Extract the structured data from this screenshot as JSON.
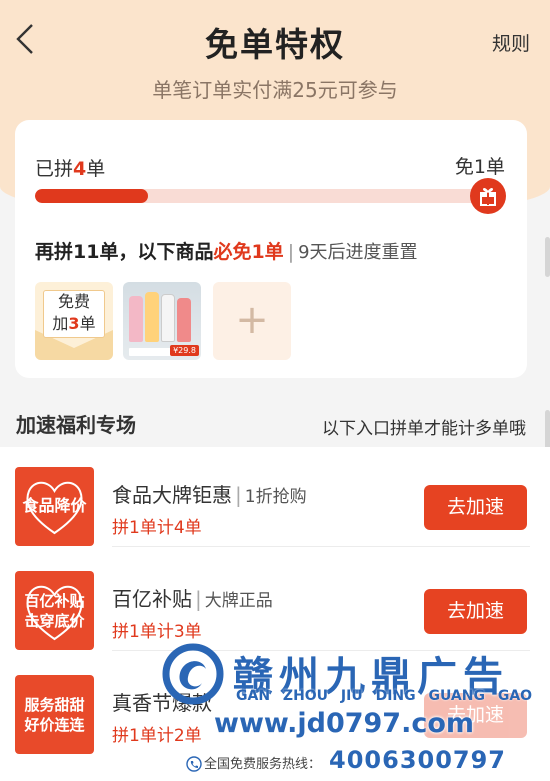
{
  "header": {
    "title": "免单特权",
    "rules_label": "规则",
    "subtitle": "单笔订单实付满25元可参与"
  },
  "progress": {
    "left_prefix": "已拼",
    "left_count": "4",
    "left_suffix": "单",
    "right_label": "免1单",
    "fill_fraction": 0.25,
    "hint_part1": "再拼11单，以下商品",
    "hint_part2": "必免1单",
    "hint_sep": "|",
    "hint_reset": "9天后进度重置"
  },
  "thumbs": {
    "free_line1": "免费",
    "free_line2_prefix": "加",
    "free_line2_num": "3",
    "free_line2_suffix": "单",
    "product_price": "¥29.8",
    "add_symbol": "+"
  },
  "section": {
    "title": "加速福利专场",
    "note": "以下入口拼单才能计多单哦"
  },
  "features": [
    {
      "badge_line1": "食品降价",
      "badge_line2": "",
      "name": "食品大牌钜惠",
      "sep": "|",
      "tag": "1折抢购",
      "count": "拼1单计4单",
      "button": "去加速"
    },
    {
      "badge_line1": "百亿补贴",
      "badge_line2": "击穿底价",
      "name": "百亿补贴",
      "sep": "|",
      "tag": "大牌正品",
      "count": "拼1单计3单",
      "button": "去加速"
    },
    {
      "badge_line1": "服务甜甜",
      "badge_line2": "好价连连",
      "name": "真香节爆款",
      "sep": "|",
      "tag": "",
      "count": "拼1单计2单",
      "button": "去加速"
    }
  ],
  "watermark": {
    "title": "赣州九鼎广告",
    "pinyin": "GAN ZHOU JIU DING GUANG GAO",
    "url": "www.jd0797.com",
    "hotline_label": "全国免费服务热线：",
    "hotline_number": "4006300797"
  },
  "colors": {
    "accent": "#e0391d",
    "header_bg": "#fbe4cc",
    "watermark_blue": "#2a66b5"
  }
}
